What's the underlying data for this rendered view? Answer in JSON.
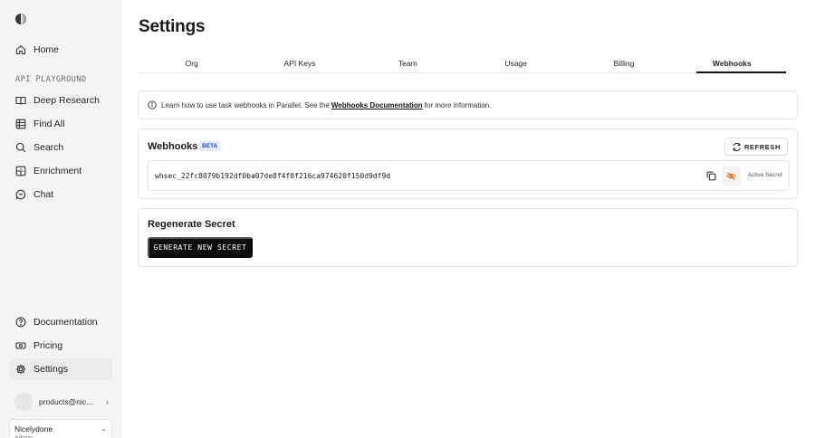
{
  "sidebar": {
    "top_items": [
      {
        "label": "Home",
        "icon": "home-icon"
      }
    ],
    "section_label": "API PLAYGROUND",
    "playground_items": [
      {
        "label": "Deep Research",
        "icon": "book-open-icon"
      },
      {
        "label": "Find All",
        "icon": "table-grid-icon"
      },
      {
        "label": "Search",
        "icon": "search-icon"
      },
      {
        "label": "Enrichment",
        "icon": "enrichment-icon"
      },
      {
        "label": "Chat",
        "icon": "chat-bubble-icon"
      }
    ],
    "bottom_items": [
      {
        "label": "Documentation",
        "icon": "help-circle-icon"
      },
      {
        "label": "Pricing",
        "icon": "dollar-badge-icon"
      },
      {
        "label": "Settings",
        "icon": "gear-icon",
        "active": true
      }
    ],
    "user": {
      "email": "products@nic..."
    },
    "org": {
      "name": "Nicelydone",
      "role": "Admin"
    }
  },
  "page": {
    "title": "Settings",
    "tabs": [
      "Org",
      "API Keys",
      "Team",
      "Usage",
      "Billing",
      "Webhooks"
    ],
    "active_tab": "Webhooks"
  },
  "info": {
    "prefix": "Learn how to use task webhooks in Parallel. See the",
    "link": "Webhooks Documentation",
    "suffix": "for more information."
  },
  "webhooks": {
    "title": "Webhooks",
    "badge": "BETA",
    "refresh_label": "REFRESH",
    "secret": "whsec_22fc8079b192df0ba07de8f4f0f216ca974620f150d9df9d",
    "secret_status": "Active Secret"
  },
  "regenerate": {
    "title": "Regenerate Secret",
    "button_label": "GENERATE NEW SECRET"
  },
  "colors": {
    "sidebar_bg": "#f4f4f5",
    "primary_button": "#0d0d0d",
    "badge_bg": "#e4ebff",
    "badge_text": "#2a4aa8"
  }
}
